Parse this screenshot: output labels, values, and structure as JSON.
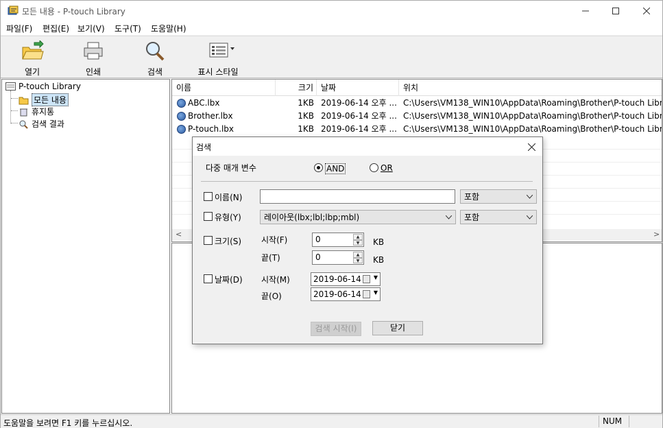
{
  "window": {
    "title": "모든 내용 - P-touch Library"
  },
  "menu": [
    "파일(F)",
    "편집(E)",
    "보기(V)",
    "도구(T)",
    "도움말(H)"
  ],
  "toolbar": {
    "open": "열기",
    "print": "인쇄",
    "search": "검색",
    "display_style": "표시 스타일"
  },
  "tree": {
    "root": "P-touch Library",
    "items": [
      "모든 내용",
      "휴지통",
      "검색 결과"
    ]
  },
  "list": {
    "columns": [
      "이름",
      "크기",
      "날짜",
      "위치"
    ],
    "rows": [
      {
        "name": "ABC.lbx",
        "size": "1KB",
        "date": "2019-06-14 오후 ...",
        "location": "C:\\Users\\VM138_WIN10\\AppData\\Roaming\\Brother\\P-touch Libr..."
      },
      {
        "name": "Brother.lbx",
        "size": "1KB",
        "date": "2019-06-14 오후 ...",
        "location": "C:\\Users\\VM138_WIN10\\AppData\\Roaming\\Brother\\P-touch Libr..."
      },
      {
        "name": "P-touch.lbx",
        "size": "1KB",
        "date": "2019-06-14 오후 ...",
        "location": "C:\\Users\\VM138_WIN10\\AppData\\Roaming\\Brother\\P-touch Libr..."
      }
    ]
  },
  "status": {
    "help": "도움말을 보려면 F1 키를 누르십시오.",
    "num": "NUM"
  },
  "dialog": {
    "title": "검색",
    "multi_param_label": "다중 매개 변수",
    "and_label": "AND",
    "or_label": "OR",
    "name_label": "이름(N)",
    "name_value": "",
    "name_match": "포함",
    "type_label": "유형(Y)",
    "type_value": "레이아웃(lbx;lbl;lbp;mbl)",
    "type_match": "포함",
    "size_label": "크기(S)",
    "size_start_label": "시작(F)",
    "size_start_value": "0",
    "size_end_label": "끝(T)",
    "size_end_value": "0",
    "kb": "KB",
    "date_label": "날짜(D)",
    "date_start_label": "시작(M)",
    "date_start_value": "2019-06-14",
    "date_end_label": "끝(O)",
    "date_end_value": "2019-06-14",
    "search_button": "검색 시작(I)",
    "close_button": "닫기"
  }
}
